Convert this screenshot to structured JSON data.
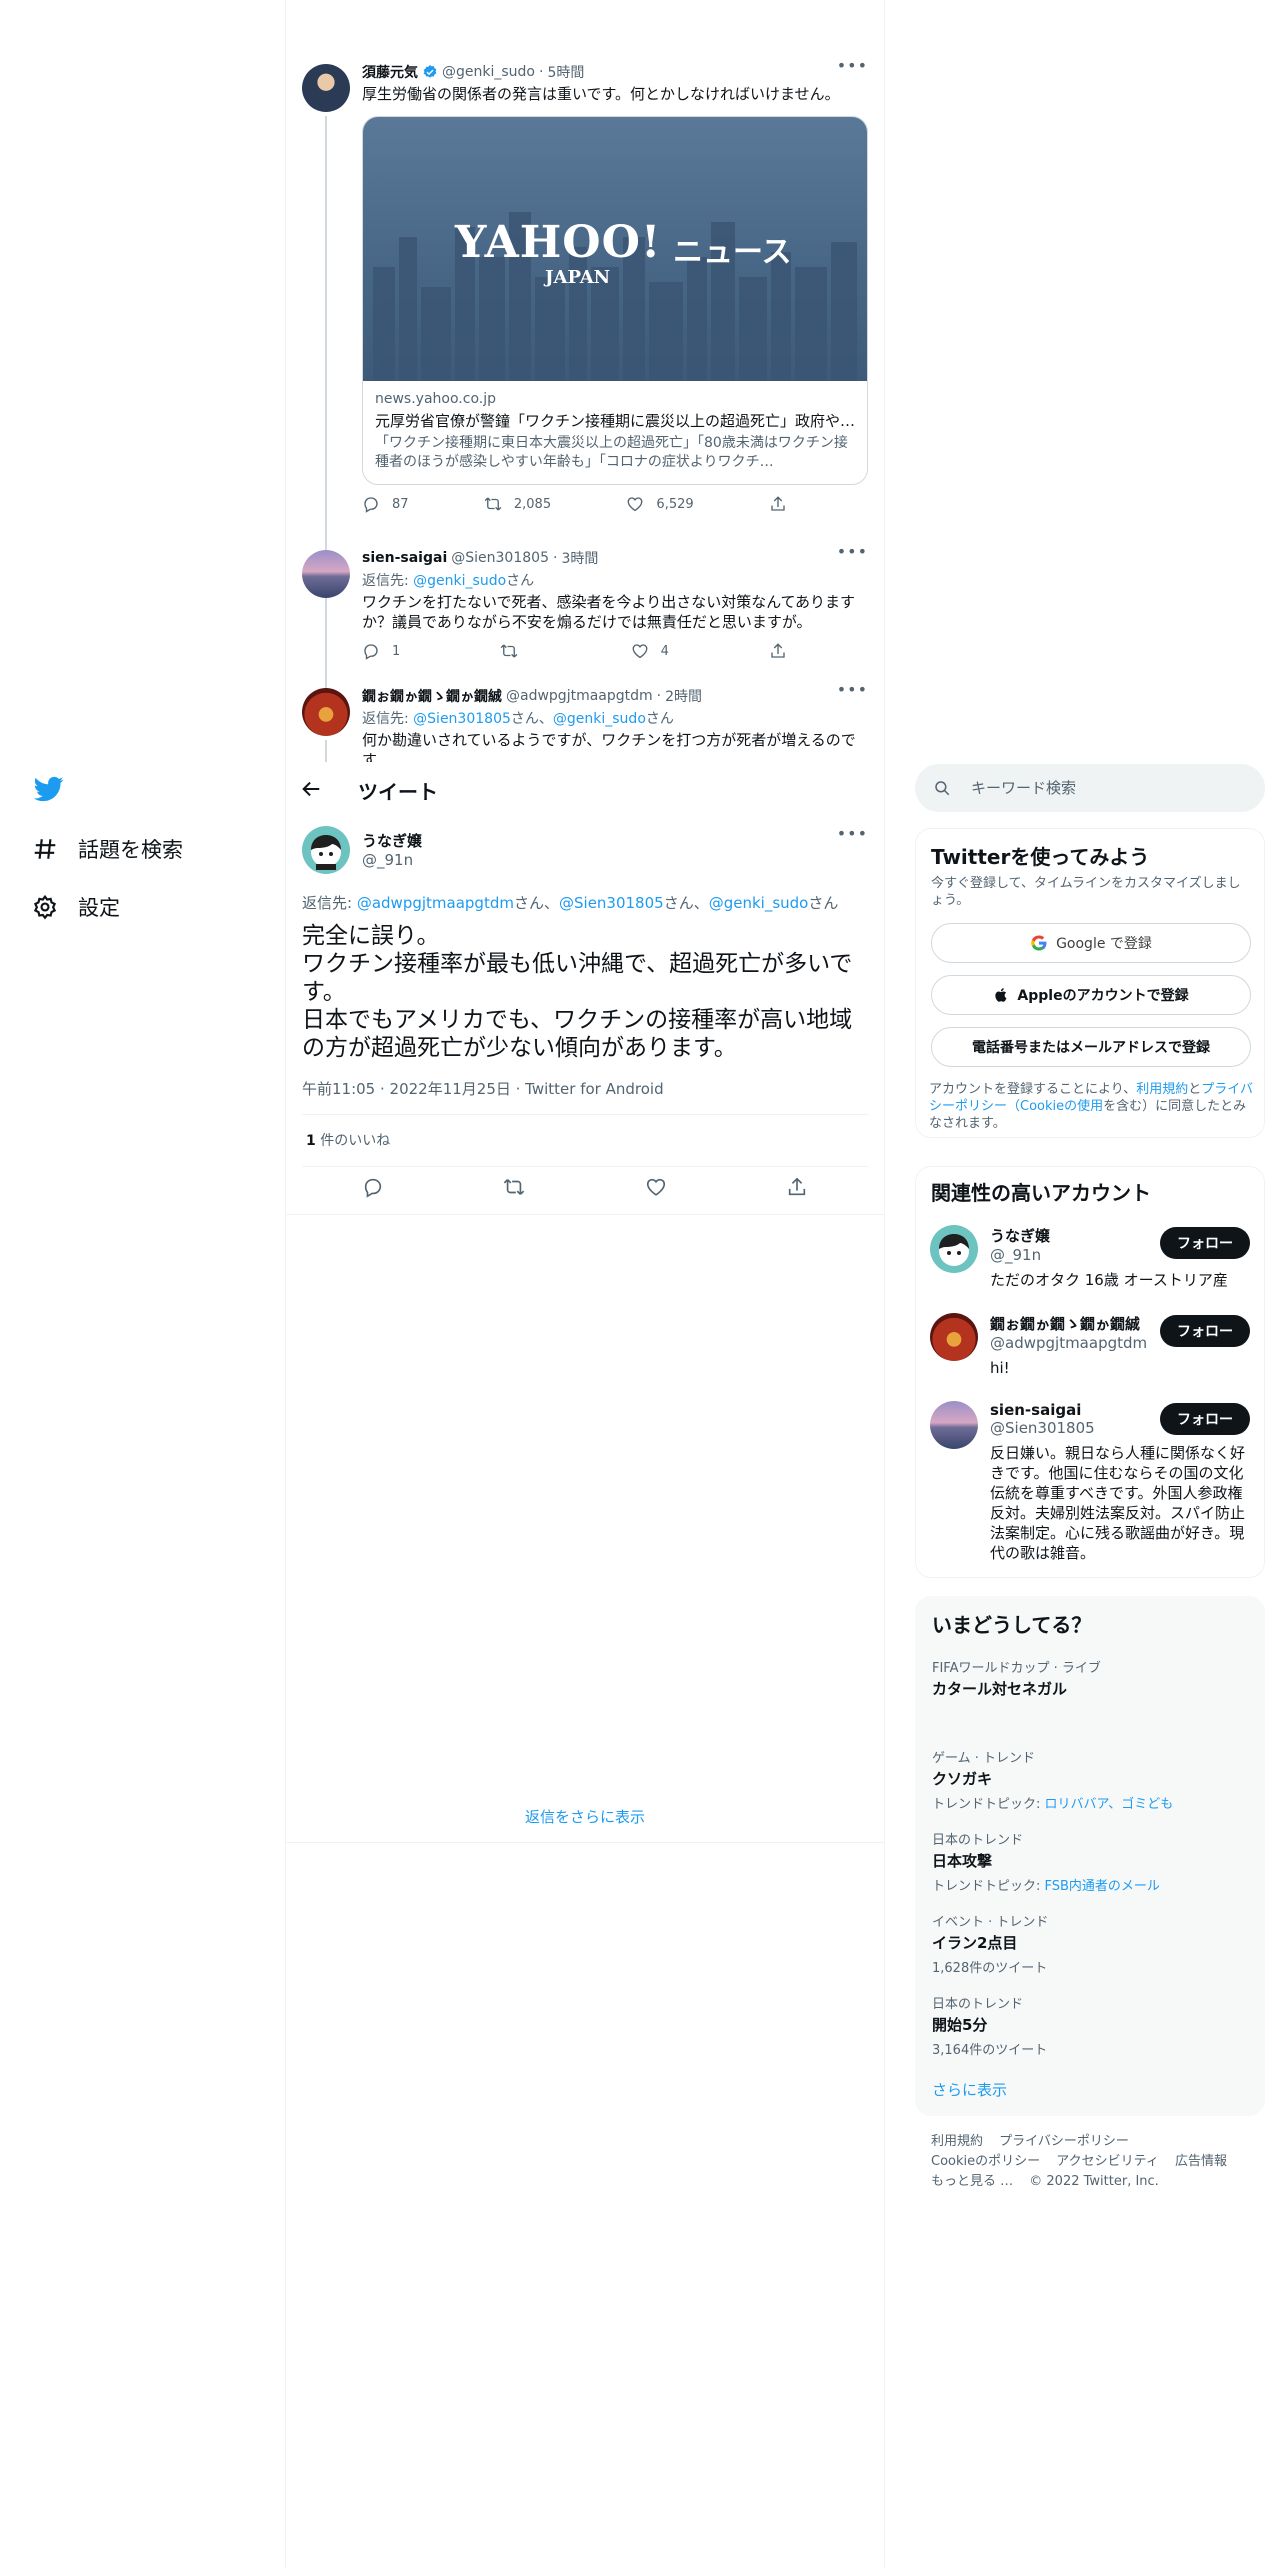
{
  "nav": {
    "items": [
      {
        "label": "話題を検索",
        "icon": "hashtag-icon"
      },
      {
        "label": "設定",
        "icon": "gear-icon"
      }
    ]
  },
  "header": {
    "title": "ツイート"
  },
  "thread": [
    {
      "name": "須藤元気",
      "handle": "@genki_sudo",
      "time": "5時間",
      "text": "厚生労働省の関係者の発言は重いです。何とかしなければいけません。",
      "card": {
        "logo_main": "YAHOO!",
        "logo_sub": "JAPAN",
        "logo_suffix": "ニュース",
        "domain": "news.yahoo.co.jp",
        "title": "元厚労省官僚が警鐘「ワクチン接種期に震災以上の超過死亡」政府や…",
        "description": "「ワクチン接種期に東日本大震災以上の超過死亡」「80歳未満はワクチン接種者のほうが感染しやすい年齢も」「コロナの症状よりワクチ…"
      },
      "stats": {
        "replies": "87",
        "retweets": "2,085",
        "likes": "6,529"
      }
    },
    {
      "name": "sien-saigai",
      "handle": "@Sien301805",
      "time": "3時間",
      "replying_prefix": "返信先:",
      "replying_to": "@genki_sudo",
      "replying_suffix": "さん",
      "text": "ワクチンを打たないで死者、感染者を今より出さない対策なんてありますか？議員でありながら不安を煽るだけでは無責任だと思いますが。",
      "stats": {
        "replies": "1",
        "retweets": "",
        "likes": "4"
      }
    },
    {
      "name": "鐗ぉ鐗ゕ鐗ゝ鐗ゕ鐗絾",
      "handle": "@adwpgjtmaapgtdm",
      "time": "2時間",
      "replying_prefix": "返信先:",
      "replying_to_1": "@Sien301805",
      "replying_mid": "さん、",
      "replying_to_2": "@genki_sudo",
      "replying_suffix": "さん",
      "text": "何か勘違いされているようですが、ワクチンを打つ方が死者が増えるのです"
    }
  ],
  "focus": {
    "name": "うなぎ嬢",
    "handle": "@_91n",
    "replying_prefix": "返信先:",
    "replying_to_1": "@adwpgjtmaapgtdm",
    "replying_sep_1": "さん、",
    "replying_to_2": "@Sien301805",
    "replying_sep_2": "さん、",
    "replying_to_3": "@genki_sudo",
    "replying_suffix": "さん",
    "text_lines": [
      "完全に誤り。",
      "ワクチン接種率が最も低い沖縄で、超過死亡が多いです。",
      "日本でもアメリカでも、ワクチンの接種率が高い地域の方が超過死亡が少ない傾向があります。"
    ],
    "timestamp": "午前11:05 · 2022年11月25日 · Twitter for Android",
    "likes_count": "1",
    "likes_label": " 件のいいね"
  },
  "more_replies": "返信をさらに表示",
  "search": {
    "placeholder": "キーワード検索"
  },
  "signup": {
    "title": "Twitterを使ってみよう",
    "subtitle": "今すぐ登録して、タイムラインをカスタマイズしましょう。",
    "google": "Google で登録",
    "apple": "Appleのアカウントで登録",
    "phone": "電話番号またはメールアドレスで登録",
    "terms_prefix": "アカウントを登録することにより、",
    "terms_link": "利用規約",
    "terms_and": "と",
    "privacy_link": "プライバシーポリシー（Cookieの使用",
    "terms_suffix": "を含む）に同意したとみなされます。"
  },
  "related": {
    "title": "関連性の高いアカウント",
    "follow_label": "フォロー",
    "accounts": [
      {
        "name": "うなぎ嬢",
        "handle": "@_91n",
        "bio": "ただのオタク 16歳 オーストリア産"
      },
      {
        "name": "鐗ぉ鐗ゕ鐗ゝ鐗ゕ鐗絾",
        "handle": "@adwpgjtmaapgtdm",
        "bio": "hi!"
      },
      {
        "name": "sien-saigai",
        "handle": "@Sien301805",
        "bio": "反日嫌い。親日なら人種に関係なく好きです。他国に住むならその国の文化伝統を尊重すべきです。外国人参政権反対。夫婦別姓法案反対。スパイ防止法案制定。心に残る歌謡曲が好き。現代の歌は雑音。"
      }
    ]
  },
  "trends": {
    "title": "いまどうしてる？",
    "items": [
      {
        "context": "FIFAワールドカップ · ライブ",
        "title": "カタール対セネガル",
        "sub": ""
      },
      {
        "context": "ゲーム · トレンド",
        "title": "クソガキ",
        "sub_prefix": "トレンドトピック: ",
        "sub_links": "ロリババア、ゴミども"
      },
      {
        "context": "日本のトレンド",
        "title": "日本攻撃",
        "sub_prefix": "トレンドトピック: ",
        "sub_links": "FSB内通者のメール"
      },
      {
        "context": "イベント · トレンド",
        "title": "イラン2点目",
        "sub": "1,628件のツイート"
      },
      {
        "context": "日本のトレンド",
        "title": "開始5分",
        "sub": "3,164件のツイート"
      }
    ],
    "show_more": "さらに表示"
  },
  "footer": {
    "line1": [
      "利用規約",
      "プライバシーポリシー"
    ],
    "line2": [
      "Cookieのポリシー",
      "アクセシビリティ",
      "広告情報"
    ],
    "line3": [
      "もっと見る …",
      "© 2022 Twitter, Inc."
    ]
  },
  "colors": {
    "accent": "#1d9bf0",
    "text": "#0f1419",
    "muted": "#536471"
  }
}
